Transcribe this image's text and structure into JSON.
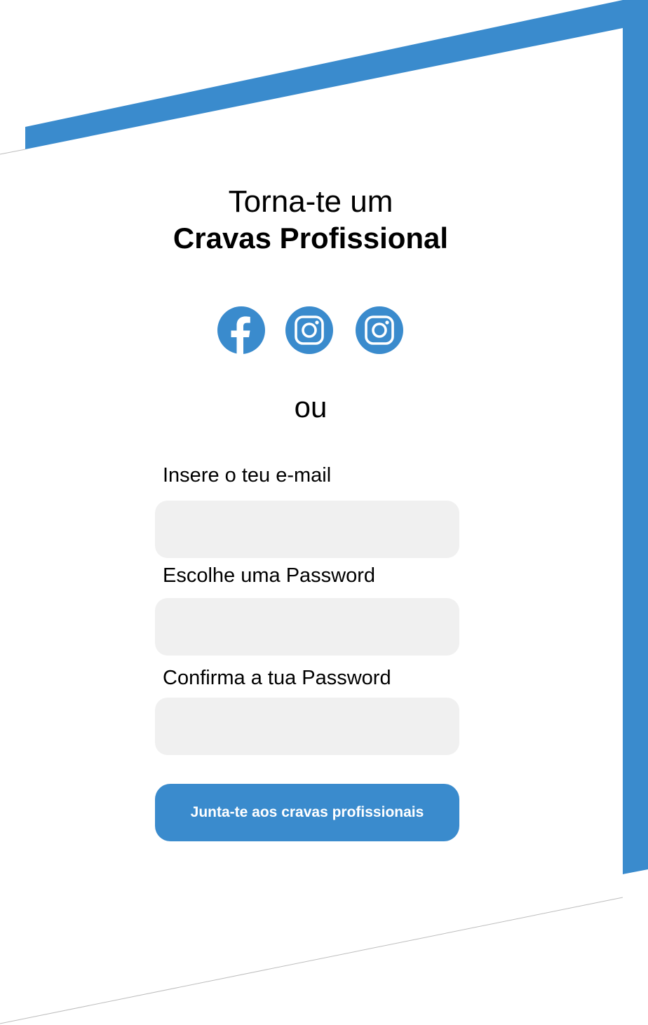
{
  "header": {
    "title_line1": "Torna-te um",
    "title_line2": "Cravas Profissional"
  },
  "social": [
    {
      "icon": "facebook-icon"
    },
    {
      "icon": "instagram-icon"
    },
    {
      "icon": "instagram-icon"
    }
  ],
  "divider_text": "ou",
  "form": {
    "email_label": "Insere o teu e-mail",
    "email_value": "",
    "password_label": "Escolhe uma Password",
    "password_value": "",
    "confirm_label": "Confirma a tua Password",
    "confirm_value": "",
    "submit_label": "Junta-te aos cravas profissionais"
  },
  "colors": {
    "accent": "#3a8bcd",
    "input_bg": "#f0f0f0"
  }
}
